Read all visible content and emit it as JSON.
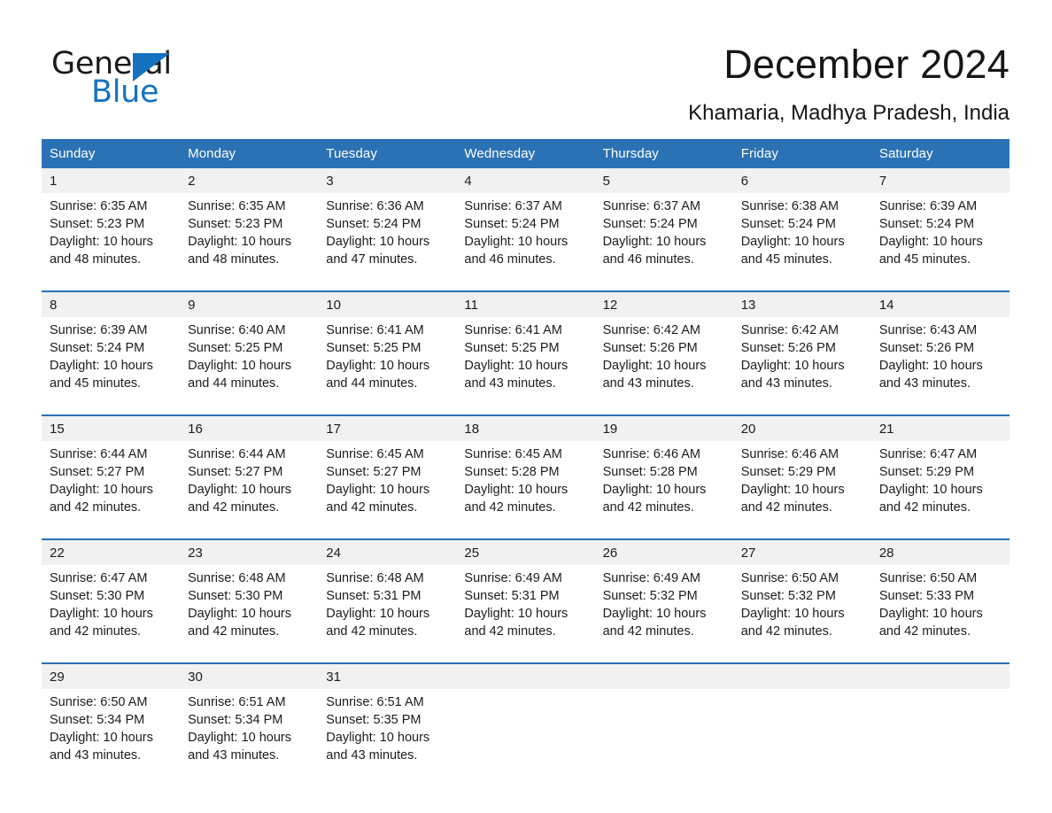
{
  "brand": {
    "name_part1": "General",
    "name_part2": "Blue",
    "triangle_color": "#1473c0",
    "text_color": "#1a1a1a"
  },
  "header": {
    "title": "December 2024",
    "location": "Khamaria, Madhya Pradesh, India"
  },
  "theme": {
    "header_bg": "#2b72b4",
    "header_text": "#ffffff",
    "daynum_bg": "#f1f1f1",
    "rule_color": "#2b72b4",
    "page_bg": "#ffffff",
    "body_text": "#1c1c1c"
  },
  "calendar": {
    "weekday_headers": [
      "Sunday",
      "Monday",
      "Tuesday",
      "Wednesday",
      "Thursday",
      "Friday",
      "Saturday"
    ],
    "weeks": [
      [
        {
          "day": "1",
          "sunrise": "Sunrise: 6:35 AM",
          "sunset": "Sunset: 5:23 PM",
          "daylight_1": "Daylight: 10 hours",
          "daylight_2": "and 48 minutes."
        },
        {
          "day": "2",
          "sunrise": "Sunrise: 6:35 AM",
          "sunset": "Sunset: 5:23 PM",
          "daylight_1": "Daylight: 10 hours",
          "daylight_2": "and 48 minutes."
        },
        {
          "day": "3",
          "sunrise": "Sunrise: 6:36 AM",
          "sunset": "Sunset: 5:24 PM",
          "daylight_1": "Daylight: 10 hours",
          "daylight_2": "and 47 minutes."
        },
        {
          "day": "4",
          "sunrise": "Sunrise: 6:37 AM",
          "sunset": "Sunset: 5:24 PM",
          "daylight_1": "Daylight: 10 hours",
          "daylight_2": "and 46 minutes."
        },
        {
          "day": "5",
          "sunrise": "Sunrise: 6:37 AM",
          "sunset": "Sunset: 5:24 PM",
          "daylight_1": "Daylight: 10 hours",
          "daylight_2": "and 46 minutes."
        },
        {
          "day": "6",
          "sunrise": "Sunrise: 6:38 AM",
          "sunset": "Sunset: 5:24 PM",
          "daylight_1": "Daylight: 10 hours",
          "daylight_2": "and 45 minutes."
        },
        {
          "day": "7",
          "sunrise": "Sunrise: 6:39 AM",
          "sunset": "Sunset: 5:24 PM",
          "daylight_1": "Daylight: 10 hours",
          "daylight_2": "and 45 minutes."
        }
      ],
      [
        {
          "day": "8",
          "sunrise": "Sunrise: 6:39 AM",
          "sunset": "Sunset: 5:24 PM",
          "daylight_1": "Daylight: 10 hours",
          "daylight_2": "and 45 minutes."
        },
        {
          "day": "9",
          "sunrise": "Sunrise: 6:40 AM",
          "sunset": "Sunset: 5:25 PM",
          "daylight_1": "Daylight: 10 hours",
          "daylight_2": "and 44 minutes."
        },
        {
          "day": "10",
          "sunrise": "Sunrise: 6:41 AM",
          "sunset": "Sunset: 5:25 PM",
          "daylight_1": "Daylight: 10 hours",
          "daylight_2": "and 44 minutes."
        },
        {
          "day": "11",
          "sunrise": "Sunrise: 6:41 AM",
          "sunset": "Sunset: 5:25 PM",
          "daylight_1": "Daylight: 10 hours",
          "daylight_2": "and 43 minutes."
        },
        {
          "day": "12",
          "sunrise": "Sunrise: 6:42 AM",
          "sunset": "Sunset: 5:26 PM",
          "daylight_1": "Daylight: 10 hours",
          "daylight_2": "and 43 minutes."
        },
        {
          "day": "13",
          "sunrise": "Sunrise: 6:42 AM",
          "sunset": "Sunset: 5:26 PM",
          "daylight_1": "Daylight: 10 hours",
          "daylight_2": "and 43 minutes."
        },
        {
          "day": "14",
          "sunrise": "Sunrise: 6:43 AM",
          "sunset": "Sunset: 5:26 PM",
          "daylight_1": "Daylight: 10 hours",
          "daylight_2": "and 43 minutes."
        }
      ],
      [
        {
          "day": "15",
          "sunrise": "Sunrise: 6:44 AM",
          "sunset": "Sunset: 5:27 PM",
          "daylight_1": "Daylight: 10 hours",
          "daylight_2": "and 42 minutes."
        },
        {
          "day": "16",
          "sunrise": "Sunrise: 6:44 AM",
          "sunset": "Sunset: 5:27 PM",
          "daylight_1": "Daylight: 10 hours",
          "daylight_2": "and 42 minutes."
        },
        {
          "day": "17",
          "sunrise": "Sunrise: 6:45 AM",
          "sunset": "Sunset: 5:27 PM",
          "daylight_1": "Daylight: 10 hours",
          "daylight_2": "and 42 minutes."
        },
        {
          "day": "18",
          "sunrise": "Sunrise: 6:45 AM",
          "sunset": "Sunset: 5:28 PM",
          "daylight_1": "Daylight: 10 hours",
          "daylight_2": "and 42 minutes."
        },
        {
          "day": "19",
          "sunrise": "Sunrise: 6:46 AM",
          "sunset": "Sunset: 5:28 PM",
          "daylight_1": "Daylight: 10 hours",
          "daylight_2": "and 42 minutes."
        },
        {
          "day": "20",
          "sunrise": "Sunrise: 6:46 AM",
          "sunset": "Sunset: 5:29 PM",
          "daylight_1": "Daylight: 10 hours",
          "daylight_2": "and 42 minutes."
        },
        {
          "day": "21",
          "sunrise": "Sunrise: 6:47 AM",
          "sunset": "Sunset: 5:29 PM",
          "daylight_1": "Daylight: 10 hours",
          "daylight_2": "and 42 minutes."
        }
      ],
      [
        {
          "day": "22",
          "sunrise": "Sunrise: 6:47 AM",
          "sunset": "Sunset: 5:30 PM",
          "daylight_1": "Daylight: 10 hours",
          "daylight_2": "and 42 minutes."
        },
        {
          "day": "23",
          "sunrise": "Sunrise: 6:48 AM",
          "sunset": "Sunset: 5:30 PM",
          "daylight_1": "Daylight: 10 hours",
          "daylight_2": "and 42 minutes."
        },
        {
          "day": "24",
          "sunrise": "Sunrise: 6:48 AM",
          "sunset": "Sunset: 5:31 PM",
          "daylight_1": "Daylight: 10 hours",
          "daylight_2": "and 42 minutes."
        },
        {
          "day": "25",
          "sunrise": "Sunrise: 6:49 AM",
          "sunset": "Sunset: 5:31 PM",
          "daylight_1": "Daylight: 10 hours",
          "daylight_2": "and 42 minutes."
        },
        {
          "day": "26",
          "sunrise": "Sunrise: 6:49 AM",
          "sunset": "Sunset: 5:32 PM",
          "daylight_1": "Daylight: 10 hours",
          "daylight_2": "and 42 minutes."
        },
        {
          "day": "27",
          "sunrise": "Sunrise: 6:50 AM",
          "sunset": "Sunset: 5:32 PM",
          "daylight_1": "Daylight: 10 hours",
          "daylight_2": "and 42 minutes."
        },
        {
          "day": "28",
          "sunrise": "Sunrise: 6:50 AM",
          "sunset": "Sunset: 5:33 PM",
          "daylight_1": "Daylight: 10 hours",
          "daylight_2": "and 42 minutes."
        }
      ],
      [
        {
          "day": "29",
          "sunrise": "Sunrise: 6:50 AM",
          "sunset": "Sunset: 5:34 PM",
          "daylight_1": "Daylight: 10 hours",
          "daylight_2": "and 43 minutes."
        },
        {
          "day": "30",
          "sunrise": "Sunrise: 6:51 AM",
          "sunset": "Sunset: 5:34 PM",
          "daylight_1": "Daylight: 10 hours",
          "daylight_2": "and 43 minutes."
        },
        {
          "day": "31",
          "sunrise": "Sunrise: 6:51 AM",
          "sunset": "Sunset: 5:35 PM",
          "daylight_1": "Daylight: 10 hours",
          "daylight_2": "and 43 minutes."
        },
        {
          "day": "",
          "sunrise": "",
          "sunset": "",
          "daylight_1": "",
          "daylight_2": ""
        },
        {
          "day": "",
          "sunrise": "",
          "sunset": "",
          "daylight_1": "",
          "daylight_2": ""
        },
        {
          "day": "",
          "sunrise": "",
          "sunset": "",
          "daylight_1": "",
          "daylight_2": ""
        },
        {
          "day": "",
          "sunrise": "",
          "sunset": "",
          "daylight_1": "",
          "daylight_2": ""
        }
      ]
    ]
  }
}
